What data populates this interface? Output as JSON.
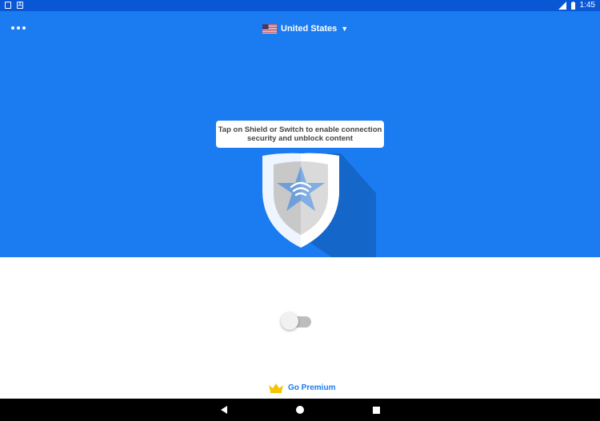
{
  "status_bar": {
    "time": "1:45",
    "left_icons": [
      "sim-card-icon",
      "notification-icon"
    ],
    "right_icons": [
      "signal-icon",
      "battery-icon"
    ]
  },
  "header": {
    "menu_icon": "more-horizontal-icon",
    "country": "United States",
    "country_flag": "us-flag-icon",
    "dropdown_caret": "▼"
  },
  "hero": {
    "tooltip_line1": "Tap on Shield or Switch to enable connection",
    "tooltip_line2": "security and unblock content",
    "shield_icon": "shield-star-wifi-icon"
  },
  "connection": {
    "switch_state": "off"
  },
  "premium": {
    "label": "Go Premium",
    "icon": "crown-icon"
  },
  "nav_bar": {
    "buttons": [
      "back-icon",
      "home-icon",
      "recent-apps-icon"
    ]
  },
  "colors": {
    "hero_blue": "#1a7cf0",
    "status_bar_blue": "#0a57d6",
    "crown_yellow": "#f5c400",
    "switch_track": "#bdbdbd"
  }
}
